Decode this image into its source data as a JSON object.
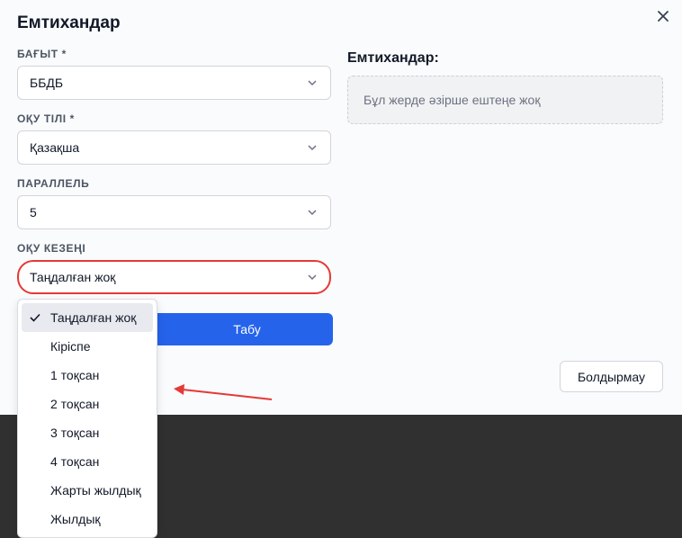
{
  "dialog": {
    "title": "Емтихандар",
    "close_icon": "close-icon"
  },
  "form": {
    "direction": {
      "label": "БАҒЫТ *",
      "value": "ББДБ"
    },
    "language": {
      "label": "ОҚУ ТІЛІ *",
      "value": "Қазақша"
    },
    "parallel": {
      "label": "ПАРАЛЛЕЛЬ",
      "value": "5"
    },
    "period": {
      "label": "ОҚУ КЕЗЕҢІ",
      "value": "Таңдалған жоқ"
    },
    "search_label": "Табу"
  },
  "results": {
    "title": "Емтихандар:",
    "empty_text": "Бұл жерде әзірше ештеңе жоқ"
  },
  "footer": {
    "cancel_label": "Болдырмау"
  },
  "period_options": [
    "Таңдалған жоқ",
    "Кіріспе",
    "1 тоқсан",
    "2 тоқсан",
    "3 тоқсан",
    "4 тоқсан",
    "Жарты жылдық",
    "Жылдық"
  ],
  "selected_option_index": 0,
  "colors": {
    "primary": "#2563eb",
    "highlight": "#e53935",
    "annotation_arrow": "#e53935",
    "backdrop": "#2f302f"
  }
}
